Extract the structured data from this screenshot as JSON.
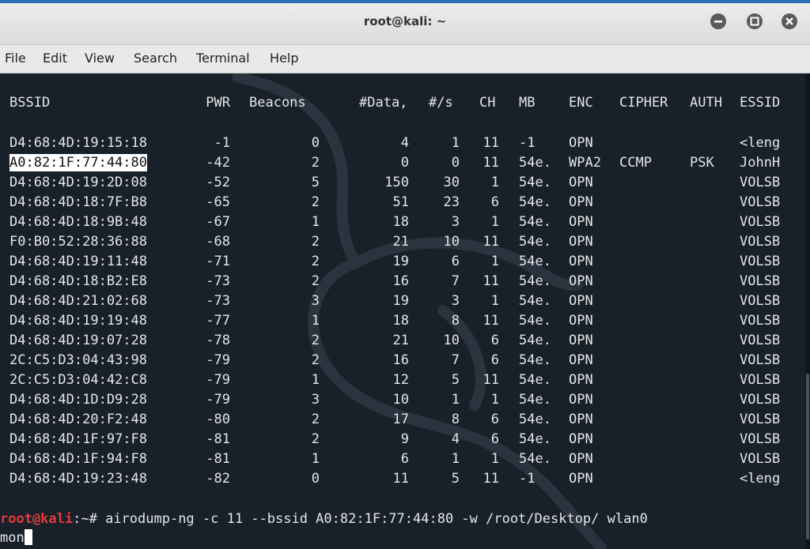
{
  "window": {
    "title": "root@kali: ~"
  },
  "menu": [
    "File",
    "Edit",
    "View",
    "Search",
    "Terminal",
    "Help"
  ],
  "columns": {
    "bssid": "BSSID",
    "pwr": "PWR",
    "beacons": "Beacons",
    "data": "#Data,",
    "per_sec": "#/s",
    "ch": "CH",
    "mb": "MB",
    "enc": "ENC",
    "cipher": "CIPHER",
    "auth": "AUTH",
    "essid": "ESSID"
  },
  "rows": [
    {
      "bssid": "D4:68:4D:19:15:18",
      "pwr": "-1",
      "beacons": "0",
      "data": "4",
      "per_sec": "1",
      "ch": "11",
      "mb": "-1",
      "enc": "OPN",
      "cipher": "",
      "auth": "",
      "essid": "<leng"
    },
    {
      "bssid": "A0:82:1F:77:44:80",
      "pwr": "-42",
      "beacons": "2",
      "data": "0",
      "per_sec": "0",
      "ch": "11",
      "mb": "54e.",
      "enc": "WPA2",
      "cipher": "CCMP",
      "auth": "PSK",
      "essid": "JohnH"
    },
    {
      "bssid": "D4:68:4D:19:2D:08",
      "pwr": "-52",
      "beacons": "5",
      "data": "150",
      "per_sec": "30",
      "ch": "1",
      "mb": "54e.",
      "enc": "OPN",
      "cipher": "",
      "auth": "",
      "essid": "VOLSB"
    },
    {
      "bssid": "D4:68:4D:18:7F:B8",
      "pwr": "-65",
      "beacons": "2",
      "data": "51",
      "per_sec": "23",
      "ch": "6",
      "mb": "54e.",
      "enc": "OPN",
      "cipher": "",
      "auth": "",
      "essid": "VOLSB"
    },
    {
      "bssid": "D4:68:4D:18:9B:48",
      "pwr": "-67",
      "beacons": "1",
      "data": "18",
      "per_sec": "3",
      "ch": "1",
      "mb": "54e.",
      "enc": "OPN",
      "cipher": "",
      "auth": "",
      "essid": "VOLSB"
    },
    {
      "bssid": "F0:B0:52:28:36:88",
      "pwr": "-68",
      "beacons": "2",
      "data": "21",
      "per_sec": "10",
      "ch": "11",
      "mb": "54e.",
      "enc": "OPN",
      "cipher": "",
      "auth": "",
      "essid": "VOLSB"
    },
    {
      "bssid": "D4:68:4D:19:11:48",
      "pwr": "-71",
      "beacons": "2",
      "data": "19",
      "per_sec": "6",
      "ch": "1",
      "mb": "54e.",
      "enc": "OPN",
      "cipher": "",
      "auth": "",
      "essid": "VOLSB"
    },
    {
      "bssid": "D4:68:4D:18:B2:E8",
      "pwr": "-73",
      "beacons": "2",
      "data": "16",
      "per_sec": "7",
      "ch": "11",
      "mb": "54e.",
      "enc": "OPN",
      "cipher": "",
      "auth": "",
      "essid": "VOLSB"
    },
    {
      "bssid": "D4:68:4D:21:02:68",
      "pwr": "-73",
      "beacons": "3",
      "data": "19",
      "per_sec": "3",
      "ch": "1",
      "mb": "54e.",
      "enc": "OPN",
      "cipher": "",
      "auth": "",
      "essid": "VOLSB"
    },
    {
      "bssid": "D4:68:4D:19:19:48",
      "pwr": "-77",
      "beacons": "1",
      "data": "18",
      "per_sec": "8",
      "ch": "11",
      "mb": "54e.",
      "enc": "OPN",
      "cipher": "",
      "auth": "",
      "essid": "VOLSB"
    },
    {
      "bssid": "D4:68:4D:19:07:28",
      "pwr": "-78",
      "beacons": "2",
      "data": "21",
      "per_sec": "10",
      "ch": "6",
      "mb": "54e.",
      "enc": "OPN",
      "cipher": "",
      "auth": "",
      "essid": "VOLSB"
    },
    {
      "bssid": "2C:C5:D3:04:43:98",
      "pwr": "-79",
      "beacons": "2",
      "data": "16",
      "per_sec": "7",
      "ch": "6",
      "mb": "54e.",
      "enc": "OPN",
      "cipher": "",
      "auth": "",
      "essid": "VOLSB"
    },
    {
      "bssid": "2C:C5:D3:04:42:C8",
      "pwr": "-79",
      "beacons": "1",
      "data": "12",
      "per_sec": "5",
      "ch": "11",
      "mb": "54e.",
      "enc": "OPN",
      "cipher": "",
      "auth": "",
      "essid": "VOLSB"
    },
    {
      "bssid": "D4:68:4D:1D:D9:28",
      "pwr": "-79",
      "beacons": "3",
      "data": "10",
      "per_sec": "1",
      "ch": "1",
      "mb": "54e.",
      "enc": "OPN",
      "cipher": "",
      "auth": "",
      "essid": "VOLSB"
    },
    {
      "bssid": "D4:68:4D:20:F2:48",
      "pwr": "-80",
      "beacons": "2",
      "data": "17",
      "per_sec": "8",
      "ch": "6",
      "mb": "54e.",
      "enc": "OPN",
      "cipher": "",
      "auth": "",
      "essid": "VOLSB"
    },
    {
      "bssid": "D4:68:4D:1F:97:F8",
      "pwr": "-81",
      "beacons": "2",
      "data": "9",
      "per_sec": "4",
      "ch": "6",
      "mb": "54e.",
      "enc": "OPN",
      "cipher": "",
      "auth": "",
      "essid": "VOLSB"
    },
    {
      "bssid": "D4:68:4D:1F:94:F8",
      "pwr": "-81",
      "beacons": "1",
      "data": "6",
      "per_sec": "1",
      "ch": "1",
      "mb": "54e.",
      "enc": "OPN",
      "cipher": "",
      "auth": "",
      "essid": "VOLSB"
    },
    {
      "bssid": "D4:68:4D:19:23:48",
      "pwr": "-82",
      "beacons": "0",
      "data": "11",
      "per_sec": "5",
      "ch": "11",
      "mb": "-1",
      "enc": "OPN",
      "cipher": "",
      "auth": "",
      "essid": "<leng"
    }
  ],
  "highlighted_bssid": "A0:82:1F:77:44:80",
  "prompt": {
    "user_host": "root@kali",
    "path_symbol": ":~# ",
    "command": "airodump-ng -c 11 --bssid A0:82:1F:77:44:80 -w /root/Desktop/ wlan0",
    "continuation": "mon"
  },
  "colors": {
    "terminal_bg": "#18202a",
    "text": "#e6e6e6",
    "prompt_user": "#e23b3b",
    "titlebar": "#e4e4e4"
  },
  "icons": {
    "minimize": "minimize-icon",
    "maximize": "maximize-icon",
    "close": "close-icon",
    "background": "kali-dragon-logo"
  }
}
